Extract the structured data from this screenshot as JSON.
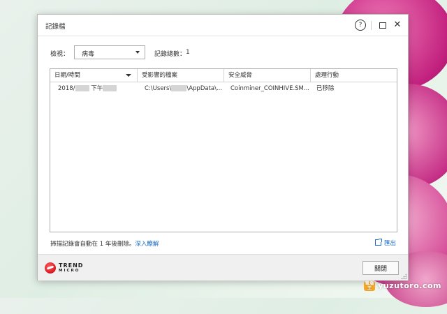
{
  "window": {
    "title": "記錄檔"
  },
  "filter": {
    "label": "檢視：",
    "selected": "病毒"
  },
  "count": {
    "label": "記錄總數：",
    "value": "1"
  },
  "table": {
    "columns": [
      "日期/時間",
      "受影響的檔案",
      "安全威脅",
      "處理行動"
    ],
    "rows": [
      {
        "date_prefix": "2018/",
        "date_mid": " 下午",
        "file_prefix": "C:\\Users\\",
        "file_suffix": "\\AppData\\...",
        "threat": "Coinminer_COINHIVE.SM...",
        "action": "已移除"
      }
    ]
  },
  "footer_note": {
    "text": "掃描記錄會自動在 1 年後刪除。",
    "link": "深入瞭解"
  },
  "export": {
    "label": "匯出"
  },
  "brand": {
    "line1": "TREND",
    "line2": "MICRO"
  },
  "buttons": {
    "close": "關閉",
    "help": "?"
  },
  "watermark": {
    "badge": "電腦王",
    "text": "yuzutoro.com"
  },
  "colors": {
    "link": "#1a6cc8",
    "brand_red": "#d71920"
  }
}
